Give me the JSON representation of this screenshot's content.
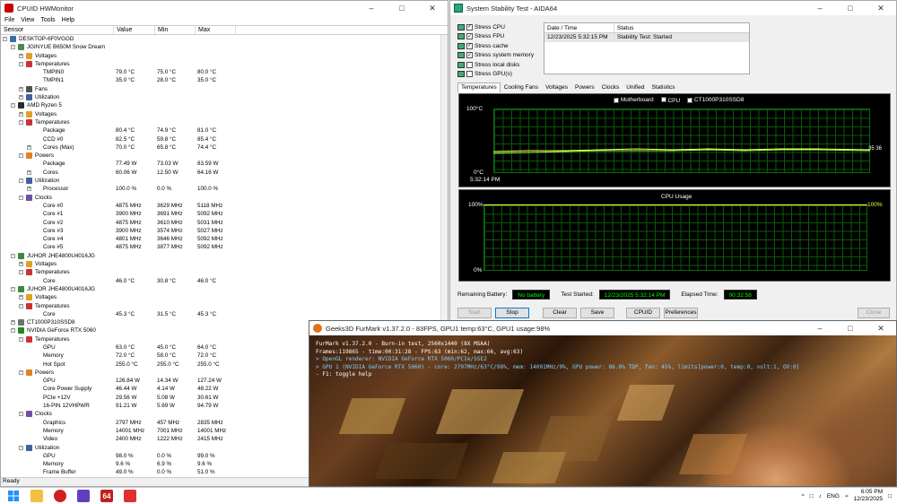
{
  "hwmonitor": {
    "title": "CPUID HWMonitor",
    "menu": [
      "File",
      "View",
      "Tools",
      "Help"
    ],
    "columns": [
      "Sensor",
      "Value",
      "Min",
      "Max"
    ],
    "status": "Ready",
    "rows": [
      {
        "d": 0,
        "e": "-",
        "ic": "pc",
        "l": "DESKTOP-6F0VGGD",
        "v": "",
        "mn": "",
        "mx": ""
      },
      {
        "d": 1,
        "e": "-",
        "ic": "mb",
        "l": "JGINYUE B650M Snow Dream",
        "v": "",
        "mn": "",
        "mx": ""
      },
      {
        "d": 2,
        "e": "+",
        "ic": "volt",
        "l": "Voltages",
        "v": "",
        "mn": "",
        "mx": ""
      },
      {
        "d": 2,
        "e": "-",
        "ic": "temp",
        "l": "Temperatures",
        "v": "",
        "mn": "",
        "mx": ""
      },
      {
        "d": 3,
        "e": "",
        "ic": "",
        "l": "TMPIN0",
        "v": "79.0 °C",
        "mn": "75.0 °C",
        "mx": "80.0 °C"
      },
      {
        "d": 3,
        "e": "",
        "ic": "",
        "l": "TMPIN1",
        "v": "35.0 °C",
        "mn": "28.0 °C",
        "mx": "35.0 °C"
      },
      {
        "d": 2,
        "e": "+",
        "ic": "fan",
        "l": "Fans",
        "v": "",
        "mn": "",
        "mx": ""
      },
      {
        "d": 2,
        "e": "+",
        "ic": "util",
        "l": "Utilization",
        "v": "",
        "mn": "",
        "mx": ""
      },
      {
        "d": 1,
        "e": "-",
        "ic": "cpu",
        "l": "AMD Ryzen 5",
        "v": "",
        "mn": "",
        "mx": ""
      },
      {
        "d": 2,
        "e": "+",
        "ic": "volt",
        "l": "Voltages",
        "v": "",
        "mn": "",
        "mx": ""
      },
      {
        "d": 2,
        "e": "-",
        "ic": "temp",
        "l": "Temperatures",
        "v": "",
        "mn": "",
        "mx": ""
      },
      {
        "d": 3,
        "e": "",
        "ic": "",
        "l": "Package",
        "v": "80.4 °C",
        "mn": "74.9 °C",
        "mx": "81.0 °C"
      },
      {
        "d": 3,
        "e": "",
        "ic": "",
        "l": "CCD #0",
        "v": "82.5 °C",
        "mn": "59.8 °C",
        "mx": "85.4 °C"
      },
      {
        "d": 3,
        "e": "+",
        "ic": "",
        "l": "Cores (Max)",
        "v": "70.0 °C",
        "mn": "65.8 °C",
        "mx": "74.4 °C"
      },
      {
        "d": 2,
        "e": "-",
        "ic": "pow",
        "l": "Powers",
        "v": "",
        "mn": "",
        "mx": ""
      },
      {
        "d": 3,
        "e": "",
        "ic": "",
        "l": "Package",
        "v": "77.49 W",
        "mn": "73.03 W",
        "mx": "83.59 W"
      },
      {
        "d": 3,
        "e": "+",
        "ic": "",
        "l": "Cores",
        "v": "60.06 W",
        "mn": "12.50 W",
        "mx": "64.16 W"
      },
      {
        "d": 2,
        "e": "-",
        "ic": "util",
        "l": "Utilization",
        "v": "",
        "mn": "",
        "mx": ""
      },
      {
        "d": 3,
        "e": "+",
        "ic": "",
        "l": "Processor",
        "v": "100.0 %",
        "mn": "0.0 %",
        "mx": "100.0 %"
      },
      {
        "d": 2,
        "e": "-",
        "ic": "clk",
        "l": "Clocks",
        "v": "",
        "mn": "",
        "mx": ""
      },
      {
        "d": 3,
        "e": "",
        "ic": "",
        "l": "Core #0",
        "v": "4875 MHz",
        "mn": "3629 MHz",
        "mx": "5118 MHz"
      },
      {
        "d": 3,
        "e": "",
        "ic": "",
        "l": "Core #1",
        "v": "3900 MHz",
        "mn": "3691 MHz",
        "mx": "5092 MHz"
      },
      {
        "d": 3,
        "e": "",
        "ic": "",
        "l": "Core #2",
        "v": "4875 MHz",
        "mn": "3610 MHz",
        "mx": "5031 MHz"
      },
      {
        "d": 3,
        "e": "",
        "ic": "",
        "l": "Core #3",
        "v": "3900 MHz",
        "mn": "3574 MHz",
        "mx": "5027 MHz"
      },
      {
        "d": 3,
        "e": "",
        "ic": "",
        "l": "Core #4",
        "v": "4801 MHz",
        "mn": "3646 MHz",
        "mx": "5092 MHz"
      },
      {
        "d": 3,
        "e": "",
        "ic": "",
        "l": "Core #5",
        "v": "4875 MHz",
        "mn": "3877 MHz",
        "mx": "5092 MHz"
      },
      {
        "d": 1,
        "e": "-",
        "ic": "ram",
        "l": "JUHOR JHE4800U4016JG",
        "v": "",
        "mn": "",
        "mx": ""
      },
      {
        "d": 2,
        "e": "+",
        "ic": "volt",
        "l": "Voltages",
        "v": "",
        "mn": "",
        "mx": ""
      },
      {
        "d": 2,
        "e": "-",
        "ic": "temp",
        "l": "Temperatures",
        "v": "",
        "mn": "",
        "mx": ""
      },
      {
        "d": 3,
        "e": "",
        "ic": "",
        "l": "Core",
        "v": "46.0 °C",
        "mn": "30.8 °C",
        "mx": "46.0 °C"
      },
      {
        "d": 1,
        "e": "-",
        "ic": "ram",
        "l": "JUHOR JHE4800U4016JG",
        "v": "",
        "mn": "",
        "mx": ""
      },
      {
        "d": 2,
        "e": "+",
        "ic": "volt",
        "l": "Voltages",
        "v": "",
        "mn": "",
        "mx": ""
      },
      {
        "d": 2,
        "e": "-",
        "ic": "temp",
        "l": "Temperatures",
        "v": "",
        "mn": "",
        "mx": ""
      },
      {
        "d": 3,
        "e": "",
        "ic": "",
        "l": "Core",
        "v": "45.3 °C",
        "mn": "31.5 °C",
        "mx": "45.3 °C"
      },
      {
        "d": 1,
        "e": "+",
        "ic": "disk",
        "l": "CT1000P310SSD8",
        "v": "",
        "mn": "",
        "mx": ""
      },
      {
        "d": 1,
        "e": "-",
        "ic": "gpu",
        "l": "NVIDIA GeForce RTX 5060",
        "v": "",
        "mn": "",
        "mx": ""
      },
      {
        "d": 2,
        "e": "-",
        "ic": "temp",
        "l": "Temperatures",
        "v": "",
        "mn": "",
        "mx": ""
      },
      {
        "d": 3,
        "e": "",
        "ic": "",
        "l": "GPU",
        "v": "63.0 °C",
        "mn": "45.0 °C",
        "mx": "64.0 °C"
      },
      {
        "d": 3,
        "e": "",
        "ic": "",
        "l": "Memory",
        "v": "72.0 °C",
        "mn": "58.0 °C",
        "mx": "72.0 °C"
      },
      {
        "d": 3,
        "e": "",
        "ic": "",
        "l": "Hot Spot",
        "v": "255.0 °C",
        "mn": "255.0 °C",
        "mx": "255.0 °C"
      },
      {
        "d": 2,
        "e": "-",
        "ic": "pow",
        "l": "Powers",
        "v": "",
        "mn": "",
        "mx": ""
      },
      {
        "d": 3,
        "e": "",
        "ic": "",
        "l": "GPU",
        "v": "126.84 W",
        "mn": "14.34 W",
        "mx": "127.24 W"
      },
      {
        "d": 3,
        "e": "",
        "ic": "",
        "l": "Core Power Supply",
        "v": "46.44 W",
        "mn": "4.14 W",
        "mx": "48.22 W"
      },
      {
        "d": 3,
        "e": "",
        "ic": "",
        "l": "PCIe +12V",
        "v": "29.56 W",
        "mn": "5.08 W",
        "mx": "30.61 W"
      },
      {
        "d": 3,
        "e": "",
        "ic": "",
        "l": "16-PIN 12VHPWR",
        "v": "91.21 W",
        "mn": "5.69 W",
        "mx": "94.79 W"
      },
      {
        "d": 2,
        "e": "-",
        "ic": "clk",
        "l": "Clocks",
        "v": "",
        "mn": "",
        "mx": ""
      },
      {
        "d": 3,
        "e": "",
        "ic": "",
        "l": "Graphics",
        "v": "2797 MHz",
        "mn": "457 MHz",
        "mx": "2835 MHz"
      },
      {
        "d": 3,
        "e": "",
        "ic": "",
        "l": "Memory",
        "v": "14001 MHz",
        "mn": "7001 MHz",
        "mx": "14001 MHz"
      },
      {
        "d": 3,
        "e": "",
        "ic": "",
        "l": "Video",
        "v": "2400 MHz",
        "mn": "1222 MHz",
        "mx": "2415 MHz"
      },
      {
        "d": 2,
        "e": "-",
        "ic": "util",
        "l": "Utilization",
        "v": "",
        "mn": "",
        "mx": ""
      },
      {
        "d": 3,
        "e": "",
        "ic": "",
        "l": "GPU",
        "v": "98.0 %",
        "mn": "0.0 %",
        "mx": "99.0 %"
      },
      {
        "d": 3,
        "e": "",
        "ic": "",
        "l": "Memory",
        "v": "9.6 %",
        "mn": "6.9 %",
        "mx": "9.6 %"
      },
      {
        "d": 3,
        "e": "",
        "ic": "",
        "l": "Frame Buffer",
        "v": "49.0 %",
        "mn": "0.0 %",
        "mx": "51.0 %"
      }
    ]
  },
  "aida": {
    "title": "System Stability Test - AIDA64",
    "stress": [
      {
        "label": "Stress CPU",
        "checked": true
      },
      {
        "label": "Stress FPU",
        "checked": true
      },
      {
        "label": "Stress cache",
        "checked": true
      },
      {
        "label": "Stress system memory",
        "checked": true
      },
      {
        "label": "Stress local disks",
        "checked": false
      },
      {
        "label": "Stress GPU(s)",
        "checked": false
      }
    ],
    "log_headers": [
      "Date / Time",
      "Status"
    ],
    "log_rows": [
      {
        "dt": "12/23/2025 5:32:15 PM",
        "st": "Stability Test: Started"
      }
    ],
    "tabs": [
      "Temperatures",
      "Cooling Fans",
      "Voltages",
      "Powers",
      "Clocks",
      "Unified",
      "Statistics"
    ],
    "temp_graph": {
      "legend": [
        {
          "label": "Motherboard",
          "checked": true
        },
        {
          "label": "CPU",
          "checked": false
        },
        {
          "label": "CT1000P310SSD8",
          "checked": true
        }
      ],
      "ymax": "100°C",
      "ymin": "0°C",
      "time": "5:32:14 PM",
      "value_label": "35 36"
    },
    "cpu_graph": {
      "title": "CPU Usage",
      "ymax": "100%",
      "ymin": "0%",
      "value_label": "100%"
    },
    "remaining_battery_label": "Remaining Battery:",
    "remaining_battery": "No battery",
    "test_started_label": "Test Started:",
    "test_started": "12/23/2025 5:32:14 PM",
    "elapsed_label": "Elapsed Time:",
    "elapsed": "00:32:58",
    "buttons": {
      "start": "Start",
      "stop": "Stop",
      "clear": "Clear",
      "save": "Save",
      "cpuid": "CPUID",
      "preferences": "Preferences",
      "close": "Close"
    }
  },
  "furmark": {
    "title": "Geeks3D FurMark v1.37.2.0 - 83FPS, GPU1 temp:63°C, GPU1 usage:98%",
    "lines": [
      {
        "t": "FurMark v1.37.2.0 - Burn-in test, 2560x1440 (8X MSAA)",
        "c": "#ffffff"
      },
      {
        "t": "Frames:119865 - time:00:31:28 - FPS:63 (min:62, max:66, avg:63)",
        "c": "#ffffff"
      },
      {
        "t": "> OpenGL renderer: NVIDIA GeForce RTX 5060/PCIe/SSE2",
        "c": "#7fd0ff"
      },
      {
        "t": "> GPU 1 (NVIDIA GeForce RTX 5060) - core: 2797MHz/63°C/98%, mem: 14001MHz/9%, GPU power: 86.8% TDP, fan: 45%, limits[power:0, temp:0, volt:1, OV:0]",
        "c": "#7fd0ff"
      },
      {
        "t": "- F1: toggle help",
        "c": "#ffffff"
      }
    ]
  },
  "taskbar": {
    "time": "6:05 PM",
    "date": "12/23/2025",
    "lang": "ENG",
    "icons": [
      "start",
      "search",
      "file-explorer",
      "furmark",
      "app-purple",
      "aida64",
      "cpuid"
    ]
  }
}
